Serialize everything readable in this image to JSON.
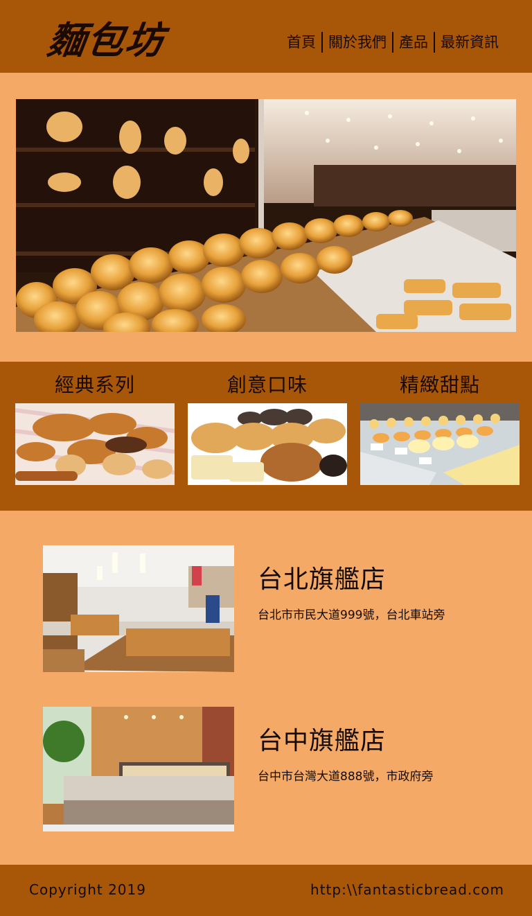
{
  "header": {
    "logo": "麵包坊",
    "nav": [
      "首頁",
      "關於我們",
      "產品",
      "最新資訊"
    ]
  },
  "hero": {
    "image": "bakery-interior-photo"
  },
  "products": [
    {
      "title": "經典系列",
      "image": "classic-bread-photo"
    },
    {
      "title": "創意口味",
      "image": "creative-bread-photo"
    },
    {
      "title": "精緻甜點",
      "image": "dessert-display-photo"
    }
  ],
  "stores": [
    {
      "name": "台北旗艦店",
      "address": "台北市市民大道999號，台北車站旁",
      "image": "taipei-store-photo"
    },
    {
      "name": "台中旗艦店",
      "address": "台中市台灣大道888號，市政府旁",
      "image": "taichung-store-photo"
    }
  ],
  "footer": {
    "copyright": "Copyright 2019",
    "url": "http:\\\\fantasticbread.com"
  },
  "colors": {
    "header_bg": "#a85608",
    "page_bg": "#f4aa66",
    "text": "#1a0a02"
  }
}
